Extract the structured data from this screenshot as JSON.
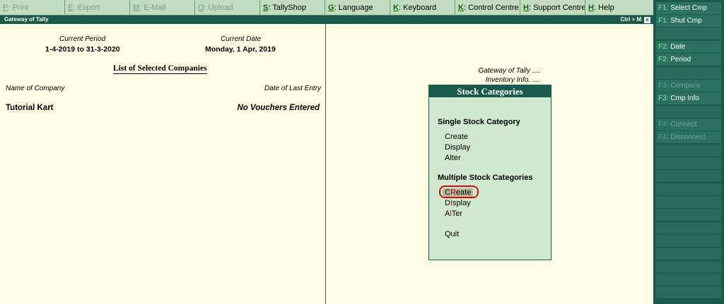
{
  "topbar": {
    "items": [
      {
        "key": "P",
        "label": ": Print",
        "enabled": false
      },
      {
        "key": "E",
        "label": ": Export",
        "enabled": false
      },
      {
        "key": "M",
        "label": ": E-Mail",
        "enabled": false
      },
      {
        "key": "O",
        "label": ": Upload",
        "enabled": false
      },
      {
        "key": "S",
        "label": ": TallyShop",
        "enabled": true
      },
      {
        "key": "G",
        "label": ": Language",
        "enabled": true
      },
      {
        "key": "K",
        "label": ": Keyboard",
        "enabled": true
      },
      {
        "key": "K",
        "label": ": Control Centre",
        "enabled": true
      },
      {
        "key": "H",
        "label": ": Support Centre",
        "enabled": true
      },
      {
        "key": "H",
        "label": ": Help",
        "enabled": true
      }
    ]
  },
  "titlebar": {
    "title": "Gateway of Tally",
    "shortcut": "Ctrl + M",
    "min_glyph": "x"
  },
  "left": {
    "current_period_label": "Current Period",
    "current_period_value": "1-4-2019 to 31-3-2020",
    "current_date_label": "Current Date",
    "current_date_value": "Monday, 1 Apr, 2019",
    "list_title": "List of Selected Companies",
    "col_name": "Name of Company",
    "col_last_entry": "Date of Last Entry",
    "company_name": "Tutorial Kart",
    "last_entry": "No Vouchers Entered"
  },
  "right": {
    "crumb_1": "Gateway of Tally ....",
    "crumb_2": "Inventory Info. ....",
    "box_title": "Stock Categories",
    "single_head": "Single Stock Category",
    "single_create": "Create",
    "single_display": "Display",
    "single_alter": "Alter",
    "multiple_head": "Multiple Stock Categories",
    "multi_create_pre": "C",
    "multi_create_hot": "R",
    "multi_create_post": "eate",
    "multi_display_pre": "D",
    "multi_display_hot": "I",
    "multi_display_post": "splay",
    "multi_alter_pre": "A",
    "multi_alter_hot": "l",
    "multi_alter_post": "Ter",
    "quit": "Quit"
  },
  "sidebar": {
    "items": [
      {
        "key": "F1:",
        "label": " Select Cmp",
        "enabled": true
      },
      {
        "key": "F1:",
        "label": " Shut Cmp",
        "enabled": true
      },
      {
        "key": "F2:",
        "label": " Date",
        "enabled": true
      },
      {
        "key": "F2:",
        "label": " Period",
        "enabled": true
      },
      {
        "key": "F3:",
        "label": " Company",
        "enabled": false
      },
      {
        "key": "F3:",
        "label": " Cmp Info",
        "enabled": true
      },
      {
        "key": "F4:",
        "label": " Connect",
        "enabled": false
      },
      {
        "key": "F4:",
        "label": " Disconnect",
        "enabled": false
      }
    ]
  }
}
